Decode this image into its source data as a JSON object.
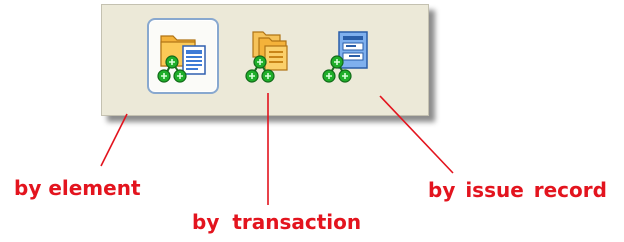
{
  "toolbar": {
    "buttons": [
      {
        "id": "by-element",
        "icon": "folder-document-node-icon",
        "selected": true
      },
      {
        "id": "by-transaction",
        "icon": "folder-stack-node-icon",
        "selected": false
      },
      {
        "id": "by-issue-record",
        "icon": "record-node-icon",
        "selected": false
      }
    ]
  },
  "labels": {
    "by_element": "by element",
    "by_transaction": "by  transaction",
    "by_issue_record": "by issue record"
  },
  "colors": {
    "annotation": "#e3141e",
    "toolbar_bg": "#ece9d8",
    "selection_border": "#88a8cf",
    "node_green": "#1fae2a",
    "folder_orange": "#f4b23a",
    "doc_blue": "#3e7bd6"
  }
}
